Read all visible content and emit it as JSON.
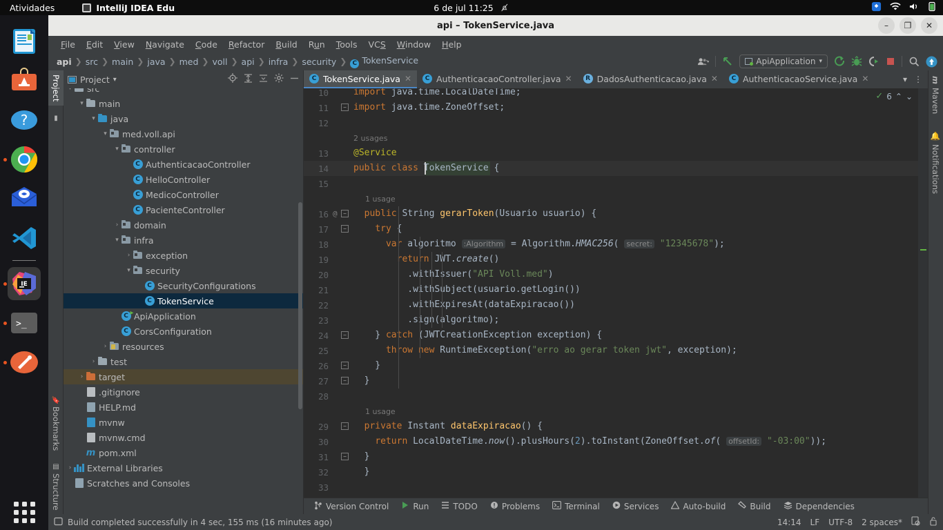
{
  "gnome": {
    "activities": "Atividades",
    "app_name": "IntelliJ IDEA Edu",
    "clock": "6 de jul 11:25",
    "bell_icon": "bell-off-icon",
    "tray": [
      "dropbox-icon",
      "wifi-icon",
      "volume-icon",
      "battery-icon"
    ]
  },
  "dock": {
    "items": [
      {
        "name": "libreoffice-writer",
        "running": false
      },
      {
        "name": "ubuntu-software",
        "running": false
      },
      {
        "name": "help",
        "running": false
      },
      {
        "name": "google-chrome",
        "running": true
      },
      {
        "name": "thunderbird-mail",
        "running": false
      },
      {
        "name": "visual-studio-code",
        "running": false
      },
      {
        "name": "intellij-idea-edu",
        "running": true,
        "active": true
      },
      {
        "name": "terminal",
        "running": true
      },
      {
        "name": "text-editor",
        "running": true
      }
    ],
    "show_apps_label": "show-applications"
  },
  "window": {
    "title": "api – TokenService.java",
    "minimize": "–",
    "maximize": "❐",
    "close": "✕"
  },
  "menubar": [
    {
      "label": "File",
      "mnemonic": "F"
    },
    {
      "label": "Edit",
      "mnemonic": "E"
    },
    {
      "label": "View",
      "mnemonic": "V"
    },
    {
      "label": "Navigate",
      "mnemonic": "N"
    },
    {
      "label": "Code",
      "mnemonic": "C"
    },
    {
      "label": "Refactor",
      "mnemonic": "R"
    },
    {
      "label": "Build",
      "mnemonic": "B"
    },
    {
      "label": "Run",
      "mnemonic": "u"
    },
    {
      "label": "Tools",
      "mnemonic": "T"
    },
    {
      "label": "VCS",
      "mnemonic": "S"
    },
    {
      "label": "Window",
      "mnemonic": "W"
    },
    {
      "label": "Help",
      "mnemonic": "H"
    }
  ],
  "breadcrumbs": [
    "api",
    "src",
    "main",
    "java",
    "med",
    "voll",
    "api",
    "infra",
    "security",
    "TokenService"
  ],
  "toolbar": {
    "account_icon": "user-account-icon",
    "updates_icon": "arrow-up-left-icon",
    "run_config": "ApiApplication",
    "run_icon": "run-icon",
    "debug_icon": "debug-icon",
    "run_with_coverage_icon": "run-coverage-icon",
    "stop_icon": "stop-icon",
    "search_icon": "search-everywhere-icon",
    "updates_badge_icon": "update-available-icon"
  },
  "left_tool_tabs": [
    {
      "label": "Project",
      "selected": true,
      "icon": "project-icon"
    },
    {
      "label": "Bookmarks",
      "selected": false,
      "icon": "bookmark-icon"
    },
    {
      "label": "Structure",
      "selected": false,
      "icon": "structure-icon"
    }
  ],
  "right_tool_tabs": [
    {
      "label": "Maven",
      "icon": "maven-icon"
    },
    {
      "label": "Notifications",
      "icon": "notifications-icon"
    }
  ],
  "project_panel": {
    "title": "Project",
    "chevron": "▾",
    "actions": [
      "locate-icon",
      "expand-all-icon",
      "collapse-all-icon",
      "settings-gear-icon",
      "hide-icon"
    ],
    "tree": [
      {
        "label": "src",
        "depth": 1,
        "arrow": "▾",
        "icon": "folder",
        "partial": true
      },
      {
        "label": "main",
        "depth": 2,
        "arrow": "▾",
        "icon": "folder"
      },
      {
        "label": "java",
        "depth": 3,
        "arrow": "▾",
        "icon": "folder-blue"
      },
      {
        "label": "med.voll.api",
        "depth": 4,
        "arrow": "▾",
        "icon": "package"
      },
      {
        "label": "controller",
        "depth": 5,
        "arrow": "▾",
        "icon": "package"
      },
      {
        "label": "AuthenticacaoController",
        "depth": 6,
        "arrow": "",
        "icon": "class",
        "clipped": true
      },
      {
        "label": "HelloController",
        "depth": 6,
        "arrow": "",
        "icon": "class"
      },
      {
        "label": "MedicoController",
        "depth": 6,
        "arrow": "",
        "icon": "class"
      },
      {
        "label": "PacienteController",
        "depth": 6,
        "arrow": "",
        "icon": "class"
      },
      {
        "label": "domain",
        "depth": 5,
        "arrow": "›",
        "icon": "package"
      },
      {
        "label": "infra",
        "depth": 5,
        "arrow": "▾",
        "icon": "package"
      },
      {
        "label": "exception",
        "depth": 6,
        "arrow": "›",
        "icon": "package"
      },
      {
        "label": "security",
        "depth": 6,
        "arrow": "▾",
        "icon": "package"
      },
      {
        "label": "SecurityConfigurations",
        "depth": 7,
        "arrow": "",
        "icon": "class",
        "clipped": true
      },
      {
        "label": "TokenService",
        "depth": 7,
        "arrow": "",
        "icon": "class",
        "selected": true
      },
      {
        "label": "ApiApplication",
        "depth": 5,
        "arrow": "",
        "icon": "class-runnable"
      },
      {
        "label": "CorsConfiguration",
        "depth": 5,
        "arrow": "",
        "icon": "class"
      },
      {
        "label": "resources",
        "depth": 4,
        "arrow": "›",
        "icon": "folder-resources"
      },
      {
        "label": "test",
        "depth": 3,
        "arrow": "›",
        "icon": "folder"
      },
      {
        "label": "target",
        "depth": 2,
        "arrow": "›",
        "icon": "folder-orange",
        "highlighted": true
      },
      {
        "label": ".gitignore",
        "depth": 2,
        "arrow": "",
        "icon": "file-gitignore"
      },
      {
        "label": "HELP.md",
        "depth": 2,
        "arrow": "",
        "icon": "file-markdown"
      },
      {
        "label": "mvnw",
        "depth": 2,
        "arrow": "",
        "icon": "file-script"
      },
      {
        "label": "mvnw.cmd",
        "depth": 2,
        "arrow": "",
        "icon": "file-text"
      },
      {
        "label": "pom.xml",
        "depth": 2,
        "arrow": "",
        "icon": "file-maven"
      },
      {
        "label": "External Libraries",
        "depth": 1,
        "arrow": "›",
        "icon": "libraries"
      },
      {
        "label": "Scratches and Consoles",
        "depth": 1,
        "arrow": "",
        "icon": "scratches"
      }
    ]
  },
  "editor_tabs": [
    {
      "label": "TokenService.java",
      "icon": "class",
      "active": true,
      "closable": true
    },
    {
      "label": "AuthenticacaoController.java",
      "icon": "class",
      "active": false,
      "closable": true
    },
    {
      "label": "DadosAuthenticacao.java",
      "icon": "record",
      "active": false,
      "closable": true
    },
    {
      "label": "AuthenticacaoService.java",
      "icon": "class",
      "active": false,
      "closable": true
    }
  ],
  "editor_tab_actions": {
    "chevron": "▾",
    "more": "⋮"
  },
  "inspections": {
    "status_icon": "inspections-ok-icon",
    "count": "6",
    "up": "⌃",
    "down": "⌄"
  },
  "code": {
    "language": "java",
    "first_visible_line": 10,
    "caret_line": 14,
    "caret_position": "14:14",
    "lines": [
      {
        "n": 10,
        "text": "import java.time.LocalDateTime;",
        "clipped_top": true
      },
      {
        "n": 11,
        "text": "import java.time.ZoneOffset;",
        "fold": "▭"
      },
      {
        "n": 12,
        "text": ""
      },
      {
        "n": null,
        "hint": "2 usages"
      },
      {
        "n": 13,
        "text": "@Service"
      },
      {
        "n": 14,
        "text": "public class TokenService {",
        "current": true
      },
      {
        "n": 15,
        "text": ""
      },
      {
        "n": null,
        "hint": "1 usage"
      },
      {
        "n": 16,
        "text": "public String gerarToken(Usuario usuario) {",
        "gutter": "@",
        "fold": "▭"
      },
      {
        "n": 17,
        "text": "try {",
        "fold": "▭"
      },
      {
        "n": 18,
        "text": "var algoritmo : Algorithm = Algorithm.HMAC256( secret: \"12345678\");"
      },
      {
        "n": 19,
        "text": "return JWT.create()"
      },
      {
        "n": 20,
        "text": ".withIssuer(\"API Voll.med\")"
      },
      {
        "n": 21,
        "text": ".withSubject(usuario.getLogin())"
      },
      {
        "n": 22,
        "text": ".withExpiresAt(dataExpiracao())"
      },
      {
        "n": 23,
        "text": ".sign(algoritmo);"
      },
      {
        "n": 24,
        "text": "} catch (JWTCreationException exception) {",
        "fold": "▭"
      },
      {
        "n": 25,
        "text": "throw new RuntimeException(\"erro ao gerar token jwt\", exception);"
      },
      {
        "n": 26,
        "text": "}",
        "fold": "▱"
      },
      {
        "n": 27,
        "text": "}",
        "fold": "▱"
      },
      {
        "n": 28,
        "text": ""
      },
      {
        "n": null,
        "hint": "1 usage"
      },
      {
        "n": 29,
        "text": "private Instant dataExpiracao() {",
        "fold": "▭"
      },
      {
        "n": 30,
        "text": "return LocalDateTime.now().plusHours(2).toInstant(ZoneOffset.of( offsetId: \"-03:00\"));"
      },
      {
        "n": 31,
        "text": "}",
        "fold": "▱"
      },
      {
        "n": 32,
        "text": "}"
      },
      {
        "n": 33,
        "text": ""
      }
    ]
  },
  "tool_window_bar": [
    {
      "label": "Version Control",
      "icon": "vcs-branch-icon"
    },
    {
      "label": "Run",
      "icon": "run-icon"
    },
    {
      "label": "TODO",
      "icon": "todo-list-icon"
    },
    {
      "label": "Problems",
      "icon": "problems-icon"
    },
    {
      "label": "Terminal",
      "icon": "terminal-icon"
    },
    {
      "label": "Services",
      "icon": "services-icon"
    },
    {
      "label": "Auto-build",
      "icon": "auto-build-icon"
    },
    {
      "label": "Build",
      "icon": "build-hammer-icon"
    },
    {
      "label": "Dependencies",
      "icon": "dependencies-icon"
    }
  ],
  "statusbar": {
    "message_icon": "build-status-icon",
    "message": "Build completed successfully in 4 sec, 155 ms (16 minutes ago)",
    "caret": "14:14",
    "line_sep": "LF",
    "encoding": "UTF-8",
    "indent": "2 spaces*",
    "gitignore_icon": "gitignore-status-icon",
    "lock_icon": "read-write-lock-icon"
  },
  "colors": {
    "accent": "#4a88c7",
    "selection": "#0d293e",
    "editor_bg": "#2b2b2b",
    "panel_bg": "#3c3f41",
    "keyword": "#cc7832",
    "string": "#6a8759",
    "annotation": "#bbb529",
    "method": "#ffc66d",
    "number": "#6897bb",
    "ubuntu_orange": "#e95420"
  }
}
